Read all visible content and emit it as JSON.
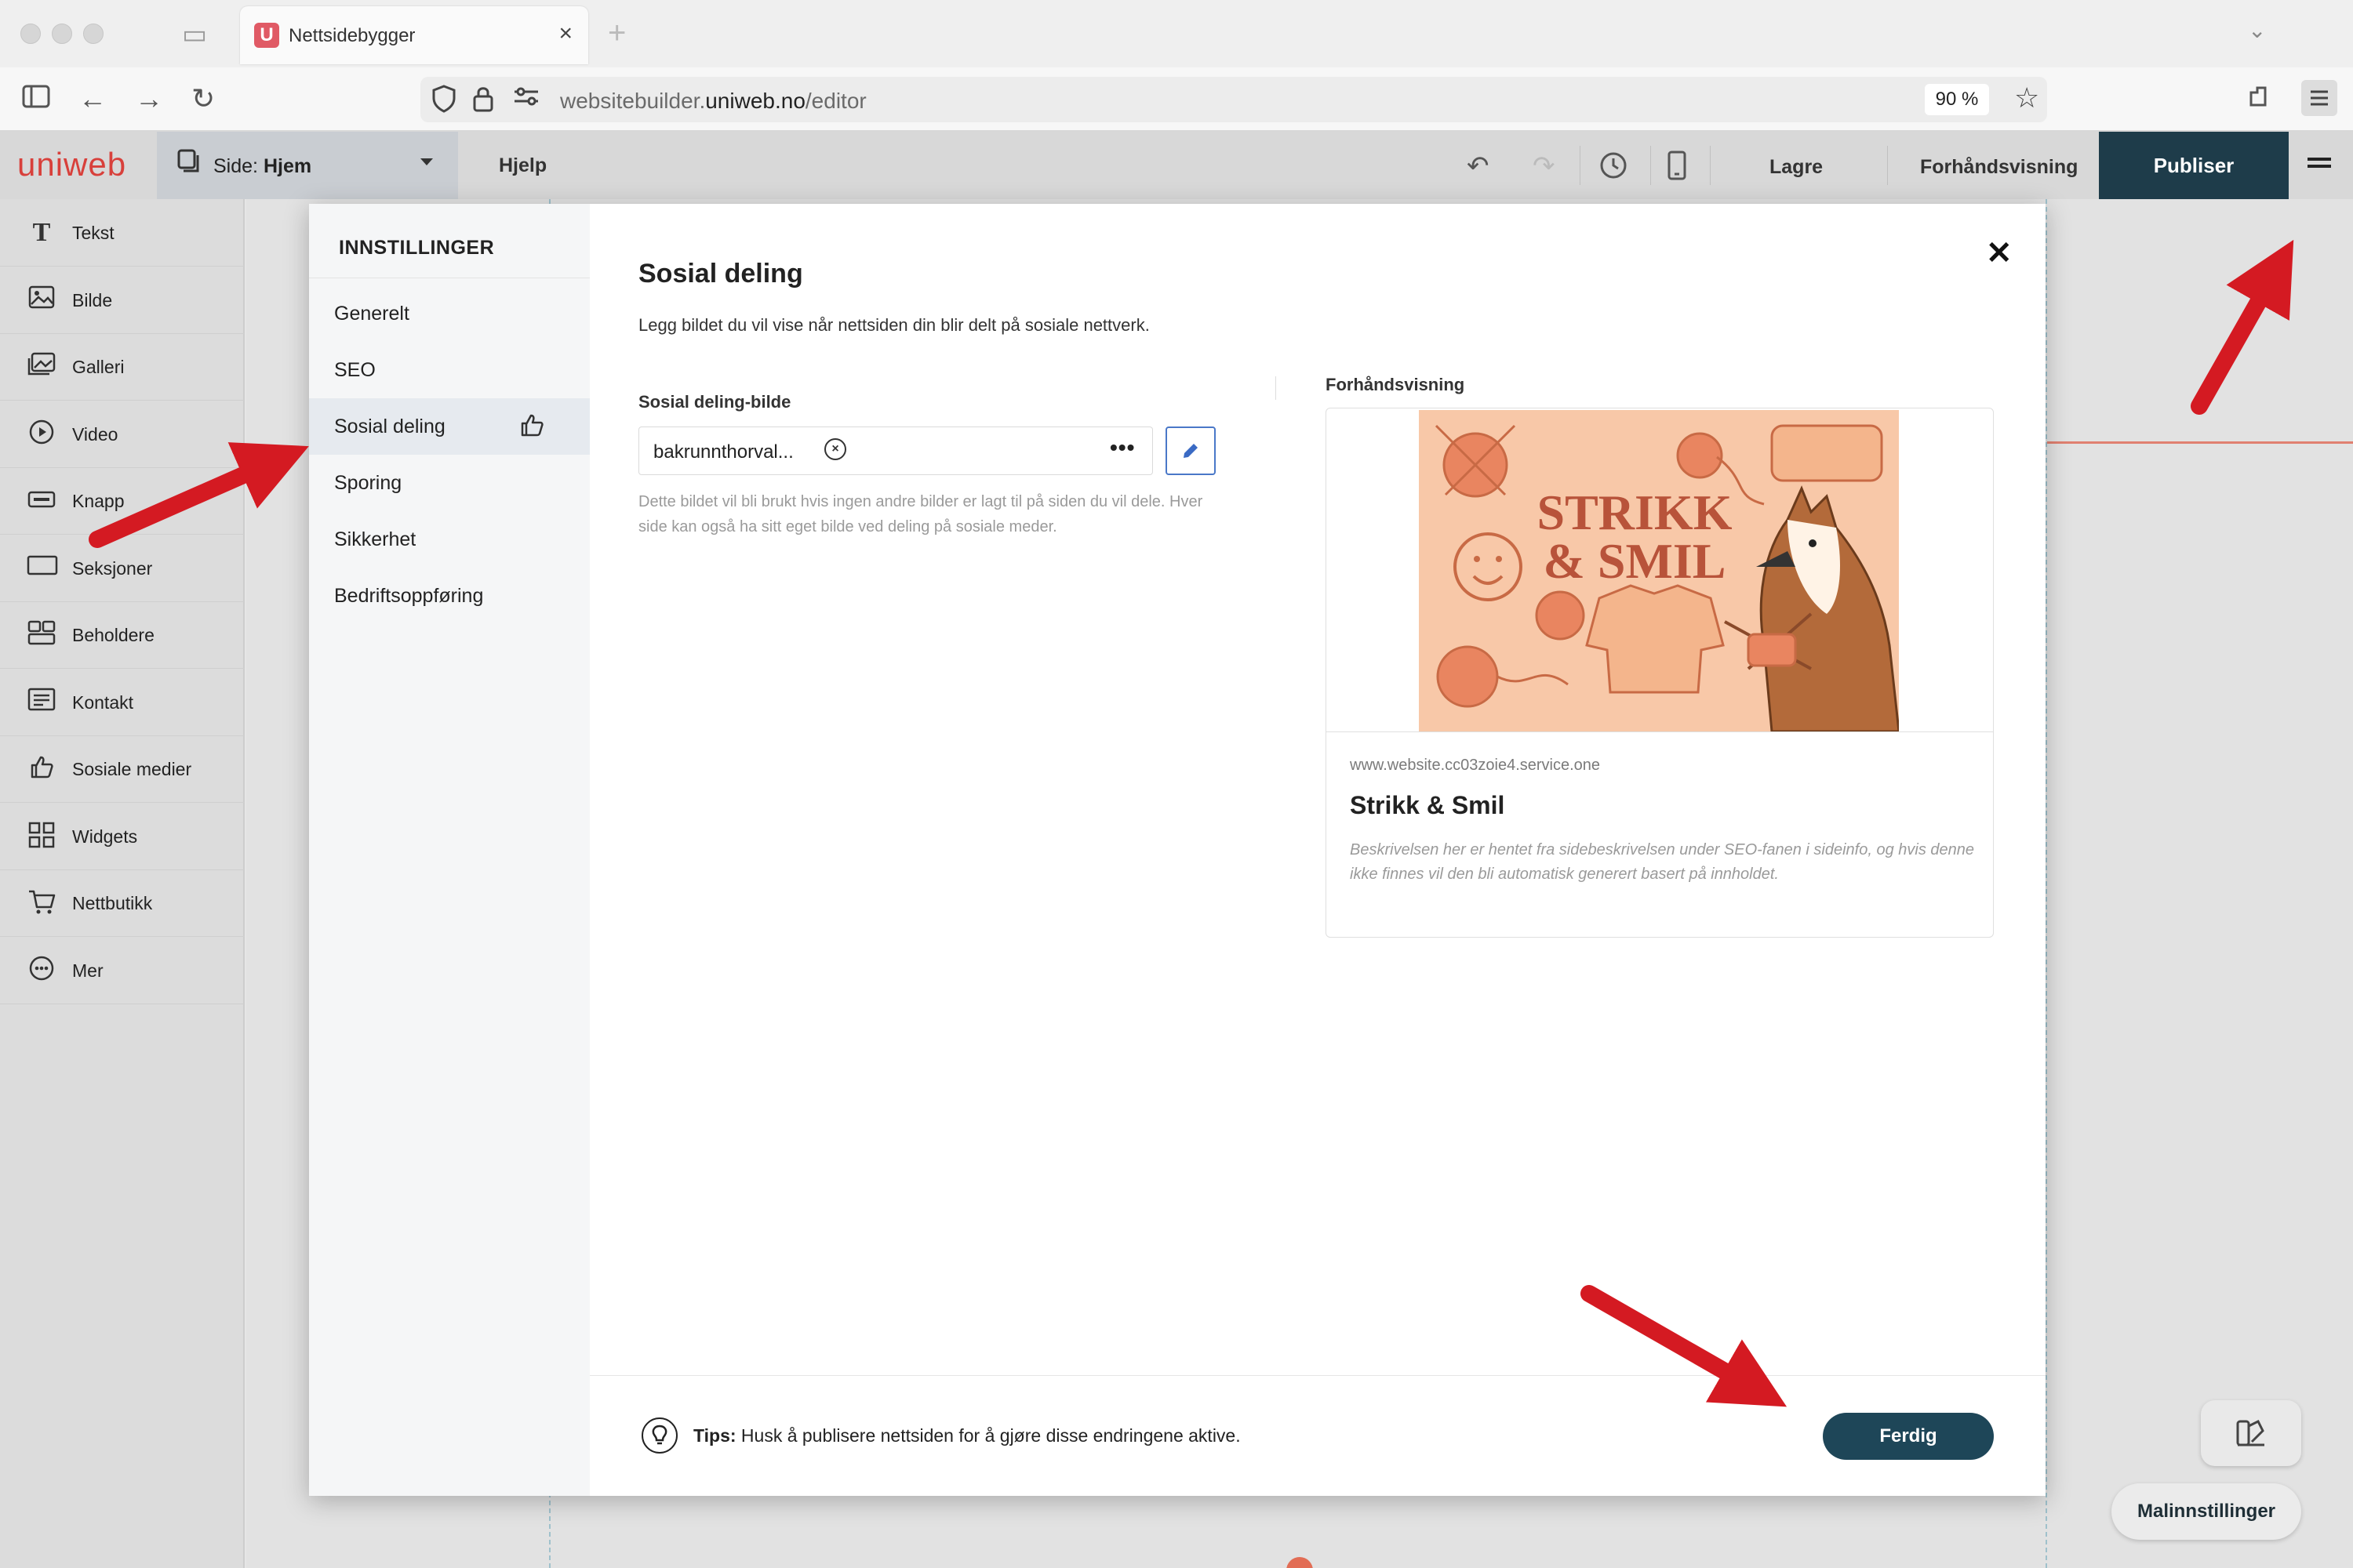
{
  "browser": {
    "tab_title": "Nettsidebygger",
    "tab_favicon": "U",
    "url_prefix": "websitebuilder.",
    "url_domain": "uniweb.no",
    "url_path": "/editor",
    "zoom": "90 %"
  },
  "editor": {
    "logo": "uniweb",
    "page_prefix": "Side: ",
    "page_name": "Hjem",
    "help": "Hjelp",
    "save": "Lagre",
    "preview": "Forhåndsvisning",
    "publish": "Publiser"
  },
  "tools": [
    {
      "label": "Tekst",
      "icon": "text-icon"
    },
    {
      "label": "Bilde",
      "icon": "image-icon"
    },
    {
      "label": "Galleri",
      "icon": "gallery-icon"
    },
    {
      "label": "Video",
      "icon": "video-icon"
    },
    {
      "label": "Knapp",
      "icon": "button-icon"
    },
    {
      "label": "Seksjoner",
      "icon": "section-icon"
    },
    {
      "label": "Beholdere",
      "icon": "container-icon"
    },
    {
      "label": "Kontakt",
      "icon": "contact-form-icon"
    },
    {
      "label": "Sosiale medier",
      "icon": "thumbs-up-icon"
    },
    {
      "label": "Widgets",
      "icon": "widgets-icon"
    },
    {
      "label": "Nettbutikk",
      "icon": "cart-icon"
    },
    {
      "label": "Mer",
      "icon": "more-icon"
    }
  ],
  "settings": {
    "title": "INNSTILLINGER",
    "nav": [
      {
        "label": "Generelt"
      },
      {
        "label": "SEO"
      },
      {
        "label": "Sosial deling",
        "active": true
      },
      {
        "label": "Sporing"
      },
      {
        "label": "Sikkerhet"
      },
      {
        "label": "Bedriftsoppføring"
      }
    ],
    "heading": "Sosial deling",
    "description": "Legg bildet du vil vise når nettsiden din blir delt på sosiale nettverk.",
    "image_label": "Sosial deling-bilde",
    "image_file": "bakrunnthorval...",
    "image_help": "Dette bildet vil bli brukt hvis ingen andre bilder er lagt til på siden du vil dele. Hver side kan også ha sitt eget bilde ved deling på sosiale meder.",
    "preview_label": "Forhåndsvisning",
    "preview": {
      "image_text_line1": "STRIKK",
      "image_text_line2": "& SMIL",
      "url": "www.website.cc03zoie4.service.one",
      "title": "Strikk & Smil",
      "description": "Beskrivelsen her er hentet fra sidebeskrivelsen under SEO-fanen i sideinfo, og hvis denne ikke finnes vil den bli automatisk generert basert på innholdet."
    },
    "tip_label": "Tips:",
    "tip_text": " Husk å publisere nettsiden for å gjøre disse endringene aktive.",
    "done": "Ferdig"
  },
  "canvas": {
    "template_settings": "Malinnstillinger"
  },
  "colors": {
    "brand_red": "#d8403b",
    "publish_bg": "#1e3c4a",
    "done_bg": "#1e4658",
    "annotation_arrow": "#d41a22"
  }
}
